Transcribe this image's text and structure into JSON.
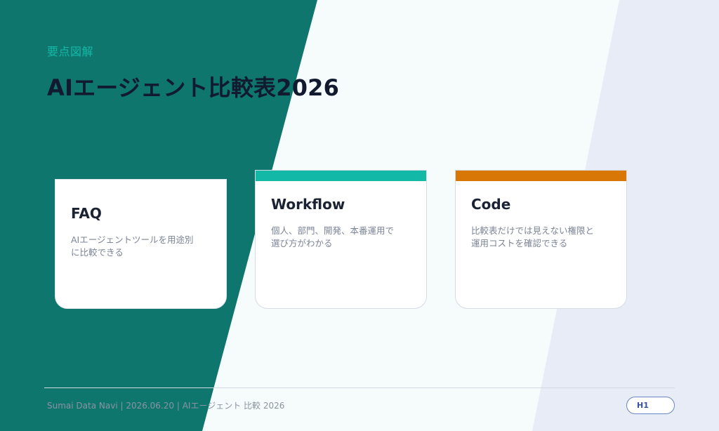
{
  "header": {
    "eyebrow": "要点図解",
    "title": "AIエージェント比較表2026"
  },
  "cards": [
    {
      "title": "FAQ",
      "desc_line1": "AIエージェントツールを用途別",
      "desc_line2": "に比較できる",
      "accent_color": ""
    },
    {
      "title": "Workflow",
      "desc_line1": "個人、部門、開発、本番運用で",
      "desc_line2": "選び方がわかる",
      "accent_color": "#14b8a6"
    },
    {
      "title": "Code",
      "desc_line1": "比較表だけでは見えない権限と",
      "desc_line2": "運用コストを確認できる",
      "accent_color": "#d97706"
    }
  ],
  "footer": {
    "text": "Sumai Data Navi | 2026.06.20 | AIエージェント 比較 2026",
    "page_label": "H1"
  },
  "colors": {
    "primary": "#0f766e",
    "light_panel": "#f6fcfc",
    "right_panel": "#e8ecf6",
    "teal_accent": "#14b8a6",
    "orange_accent": "#d97706"
  }
}
